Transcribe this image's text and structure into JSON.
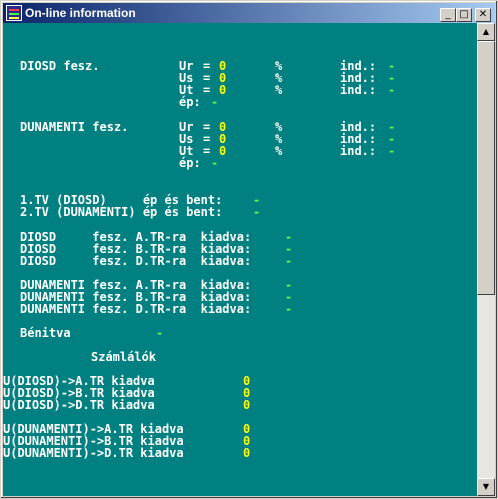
{
  "window": {
    "title": "On-line information",
    "buttons": {
      "minimize": "_",
      "maximize": "□",
      "close": "✕"
    }
  },
  "scrollbar": {
    "up": "▲",
    "down": "▼"
  },
  "sections": {
    "diosd": {
      "label": "DIOSD fesz.",
      "rows": [
        {
          "name": "Ur",
          "value": "0",
          "unit": "%",
          "ind_label": "ind.:",
          "ind_value": "-"
        },
        {
          "name": "Us",
          "value": "0",
          "unit": "%",
          "ind_label": "ind.:",
          "ind_value": "-"
        },
        {
          "name": "Ut",
          "value": "0",
          "unit": "%",
          "ind_label": "ind.:",
          "ind_value": "-"
        }
      ],
      "ep_label": "ép:",
      "ep_value": "-"
    },
    "dunamenti": {
      "label": "DUNAMENTI fesz.",
      "rows": [
        {
          "name": "Ur",
          "value": "0",
          "unit": "%",
          "ind_label": "ind.:",
          "ind_value": "-"
        },
        {
          "name": "Us",
          "value": "0",
          "unit": "%",
          "ind_label": "ind.:",
          "ind_value": "-"
        },
        {
          "name": "Ut",
          "value": "0",
          "unit": "%",
          "ind_label": "ind.:",
          "ind_value": "-"
        }
      ],
      "ep_label": "ép:",
      "ep_value": "-"
    },
    "tv": [
      {
        "label": "1.TV (DIOSD)     ép és bent:",
        "value": "-"
      },
      {
        "label": "2.TV (DUNAMENTI) ép és bent:",
        "value": "-"
      }
    ],
    "diosd_tr": [
      {
        "label": "DIOSD     fesz. A.TR-ra  kiadva:",
        "value": "-"
      },
      {
        "label": "DIOSD     fesz. B.TR-ra  kiadva:",
        "value": "-"
      },
      {
        "label": "DIOSD     fesz. D.TR-ra  kiadva:",
        "value": "-"
      }
    ],
    "dunamenti_tr": [
      {
        "label": "DUNAMENTI fesz. A.TR-ra  kiadva:",
        "value": "-"
      },
      {
        "label": "DUNAMENTI fesz. B.TR-ra  kiadva:",
        "value": "-"
      },
      {
        "label": "DUNAMENTI fesz. D.TR-ra  kiadva:",
        "value": "-"
      }
    ],
    "benitva": {
      "label": "Bénitva",
      "value": "-"
    },
    "counters_title": "Számlálók",
    "counters_diosd": [
      {
        "label": "U(DIOSD)->A.TR kiadva",
        "value": "0"
      },
      {
        "label": "U(DIOSD)->B.TR kiadva",
        "value": "0"
      },
      {
        "label": "U(DIOSD)->D.TR kiadva",
        "value": "0"
      }
    ],
    "counters_dunamenti": [
      {
        "label": "U(DUNAMENTI)->A.TR kiadva",
        "value": "0"
      },
      {
        "label": "U(DUNAMENTI)->B.TR kiadva",
        "value": "0"
      },
      {
        "label": "U(DUNAMENTI)->D.TR kiadva",
        "value": "0"
      }
    ]
  }
}
